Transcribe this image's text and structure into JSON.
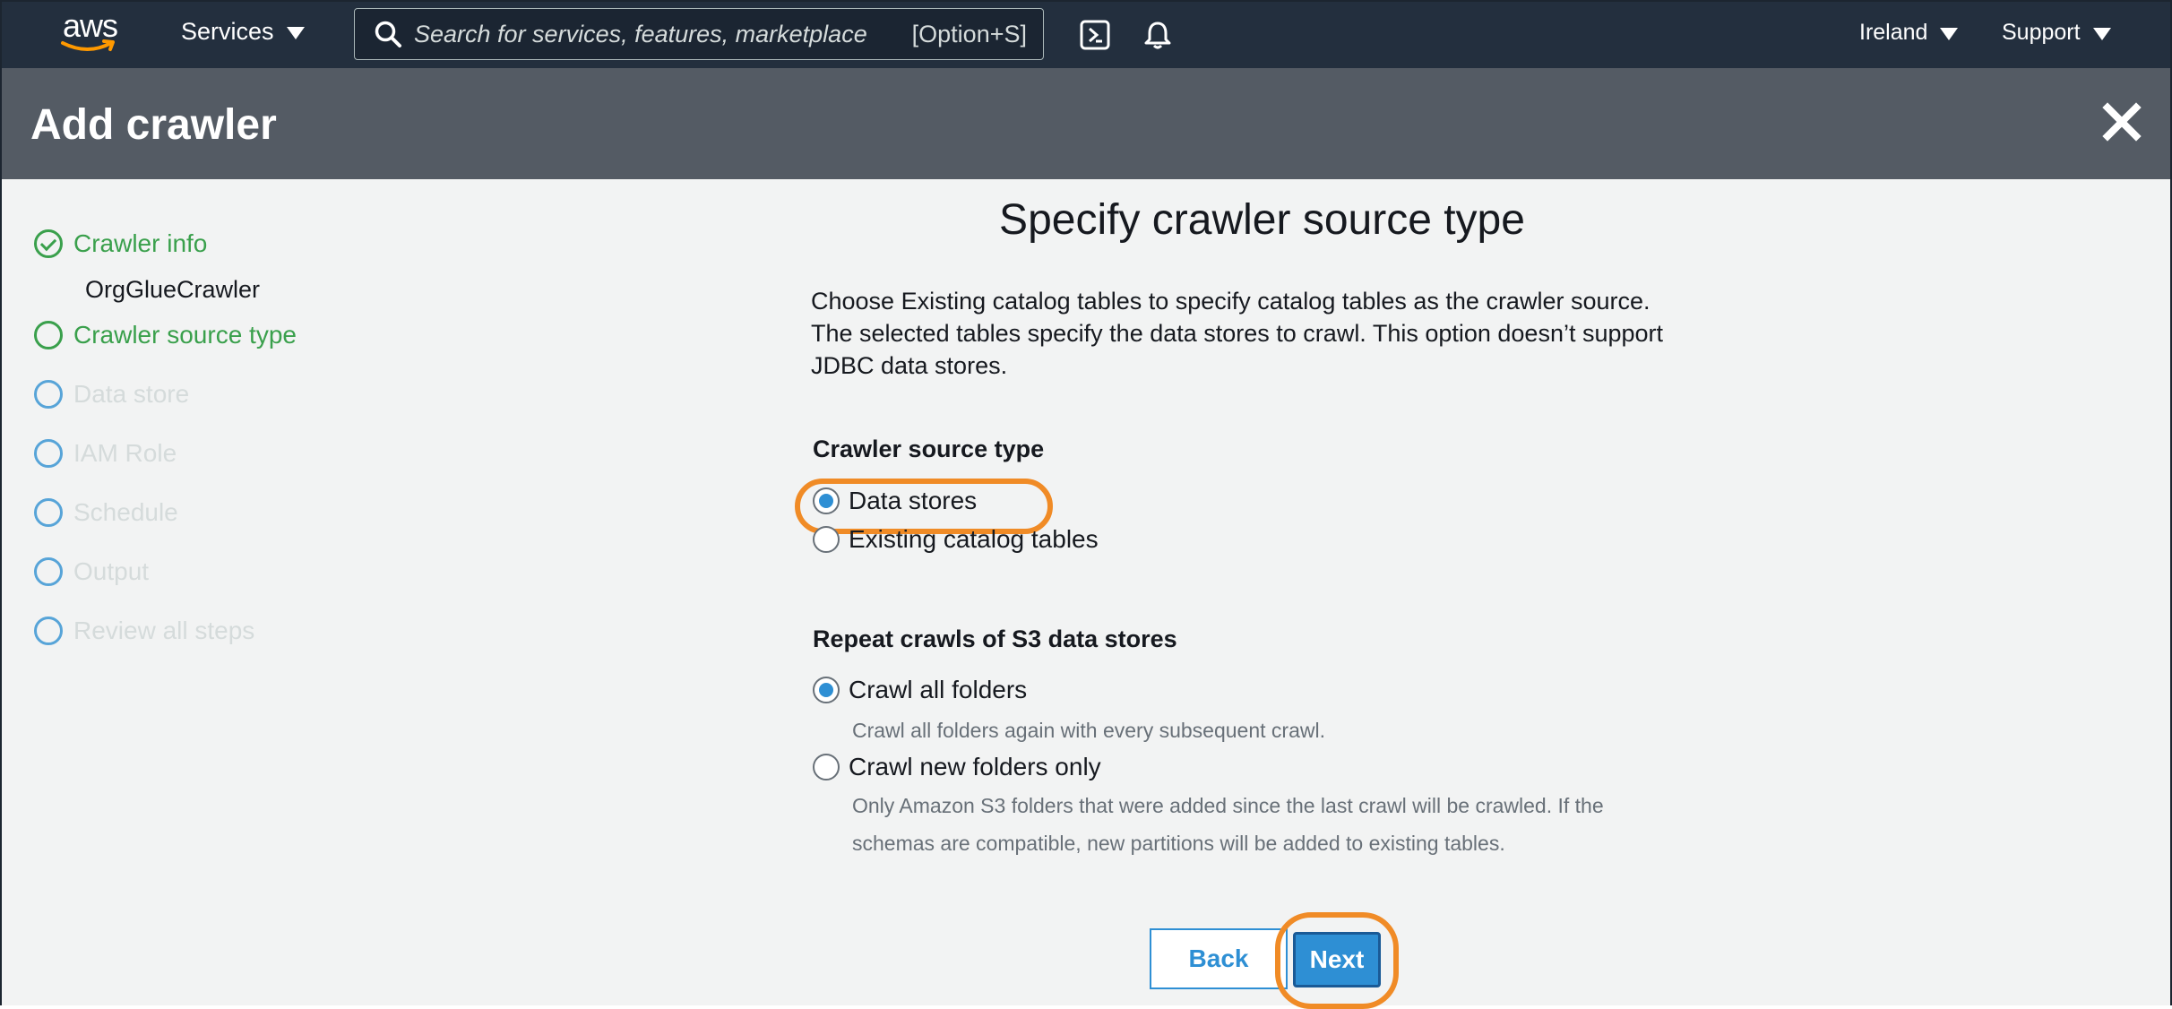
{
  "topnav": {
    "logo_text": "aws",
    "services_label": "Services",
    "search_placeholder": "Search for services, features, marketplace ",
    "search_shortcut": "[Option+S]",
    "region_label": "Ireland",
    "support_label": "Support"
  },
  "page": {
    "title": "Add crawler"
  },
  "sidebar": {
    "steps": [
      {
        "label": "Crawler info",
        "state": "done"
      },
      {
        "label": "Crawler source type",
        "state": "active"
      },
      {
        "label": "Data store",
        "state": "pending"
      },
      {
        "label": "IAM Role",
        "state": "pending"
      },
      {
        "label": "Schedule",
        "state": "pending"
      },
      {
        "label": "Output",
        "state": "pending"
      },
      {
        "label": "Review all steps",
        "state": "pending"
      }
    ],
    "crawler_name": "OrgGlueCrawler"
  },
  "main": {
    "heading": "Specify crawler source type",
    "description_lines": [
      "Choose Existing catalog tables to specify catalog tables as the crawler source.",
      "The selected tables specify the data stores to crawl. This option doesn’t support",
      "JDBC data stores."
    ],
    "source_type": {
      "label": "Crawler source type",
      "options": [
        {
          "label": "Data stores",
          "selected": true
        },
        {
          "label": "Existing catalog tables",
          "selected": false
        }
      ]
    },
    "repeat_crawls": {
      "label": "Repeat crawls of S3 data stores",
      "options": [
        {
          "label": "Crawl all folders",
          "selected": true,
          "hint": "Crawl all folders again with every subsequent crawl."
        },
        {
          "label": "Crawl new folders only",
          "selected": false,
          "hint_lines": [
            "Only Amazon S3 folders that were added since the last crawl will be crawled. If the",
            "schemas are compatible, new partitions will be added to existing tables."
          ]
        }
      ]
    },
    "back_label": "Back",
    "next_label": "Next"
  },
  "colors": {
    "nav_bg": "#232f3e",
    "title_bg": "#545b64",
    "step_done": "#3aa04c",
    "step_pending": "#57a4d8",
    "primary": "#2e8fd4",
    "highlight": "#f08b26"
  }
}
